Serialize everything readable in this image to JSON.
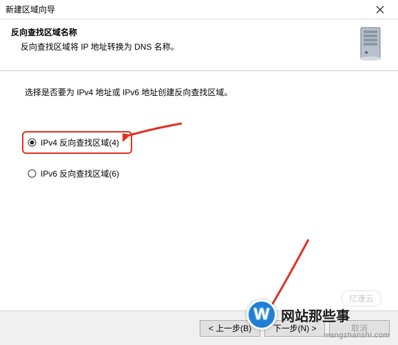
{
  "titlebar": {
    "title": "新建区域向导"
  },
  "header": {
    "title": "反向查找区域名称",
    "desc": "反向查找区域将 IP 地址转换为 DNS 名称。"
  },
  "body": {
    "instruction": "选择是否要为 IPv4 地址或 IPv6 地址创建反向查找区域。",
    "option_ipv4": "IPv4 反向查找区域(4)",
    "option_ipv6": "IPv6 反向查找区域(6)"
  },
  "footer": {
    "back": "< 上一步(B)",
    "next": "下一步(N) >",
    "cancel": "取消"
  },
  "overlay": {
    "logo_letter": "W",
    "logo_text": "网站那些事",
    "sub": "wangzhanshi.com",
    "faint": "亿速云"
  },
  "icons": {
    "close": "close-icon",
    "server": "server-icon"
  }
}
